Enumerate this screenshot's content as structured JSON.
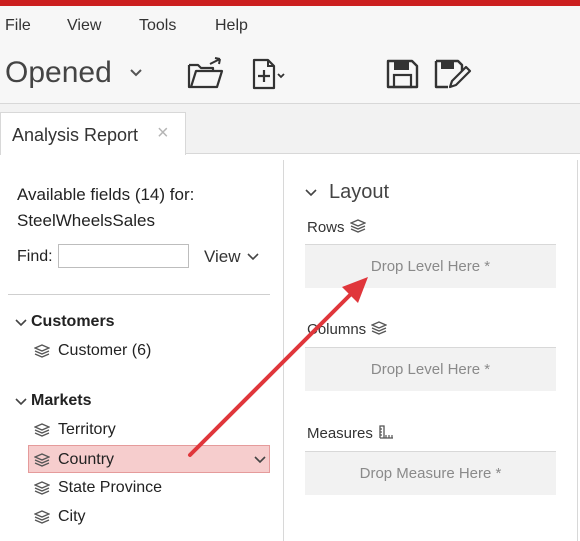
{
  "menu": {
    "file": "File",
    "view": "View",
    "tools": "Tools",
    "help": "Help"
  },
  "toolbar": {
    "opened_label": "Opened",
    "icons": [
      "open-folder-icon",
      "new-file-icon",
      "save-icon",
      "save-as-icon"
    ]
  },
  "tab": {
    "label": "Analysis Report",
    "close": "×"
  },
  "fields_panel": {
    "available_line1": "Available fields (14) for:",
    "available_line2": "SteelWheelsSales",
    "find_label": "Find:",
    "find_value": "",
    "view_label": "View",
    "groups": [
      {
        "name": "Customers",
        "items": [
          "Customer (6)"
        ]
      },
      {
        "name": "Markets",
        "items": [
          "Territory",
          "Country",
          "State Province",
          "City"
        ]
      }
    ]
  },
  "layout_panel": {
    "title": "Layout",
    "rows_label": "Rows",
    "rows_drop": "Drop Level Here *",
    "columns_label": "Columns",
    "columns_drop": "Drop Level Here *",
    "measures_label": "Measures",
    "measures_drop": "Drop Measure Here *"
  },
  "colors": {
    "accent": "#cc1f1f",
    "highlight": "#f6cdcd",
    "arrow": "#e0363b"
  }
}
